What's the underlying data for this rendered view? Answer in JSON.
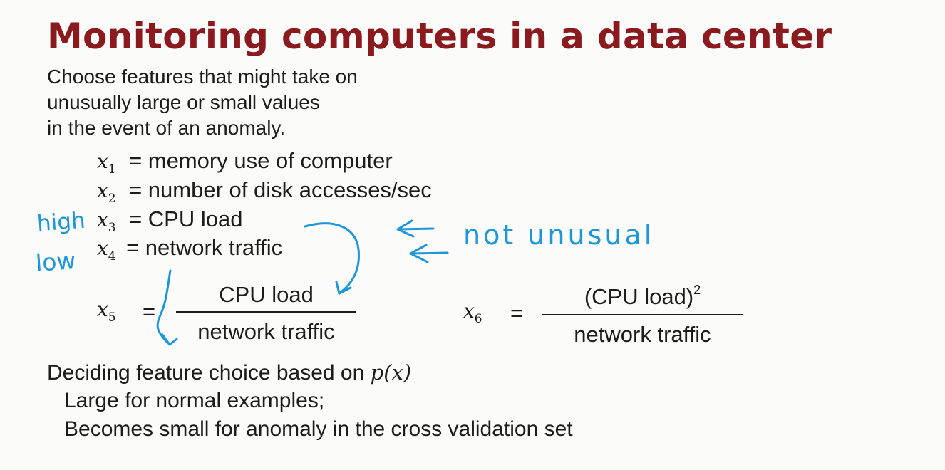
{
  "title": "Monitoring computers in a data center",
  "intro": [
    "Choose features that might take on",
    "unusually large or small values",
    "in the event of an anomaly."
  ],
  "features": [
    {
      "var": "x",
      "sub": "1",
      "desc": "= memory use of computer"
    },
    {
      "var": "x",
      "sub": "2",
      "desc": "= number of disk accesses/sec"
    },
    {
      "var": "x",
      "sub": "3",
      "desc": "= CPU load"
    },
    {
      "var": "x",
      "sub": "4",
      "desc": "= network traffic"
    }
  ],
  "x5": {
    "var": "x",
    "sub": "5",
    "eq": "=",
    "numerator": "CPU load",
    "denominator": "network traffic"
  },
  "x6": {
    "var": "x",
    "sub": "6",
    "eq": "=",
    "numerator": "(CPU load)",
    "numerator_sup": "2",
    "denominator": "network traffic"
  },
  "bottom": {
    "line1": "Deciding feature choice based on",
    "px": "p(x)",
    "line2": "Large for normal examples;",
    "line3": "Becomes small for anomaly in the cross validation set"
  },
  "annotations": {
    "high": "high",
    "low": "low",
    "not_unusual": "not unusual",
    "ink_color": "#1e97d8"
  },
  "colors": {
    "title": "#8b1a1f",
    "text": "#1c1c1c",
    "background": "#fbfbfa"
  }
}
